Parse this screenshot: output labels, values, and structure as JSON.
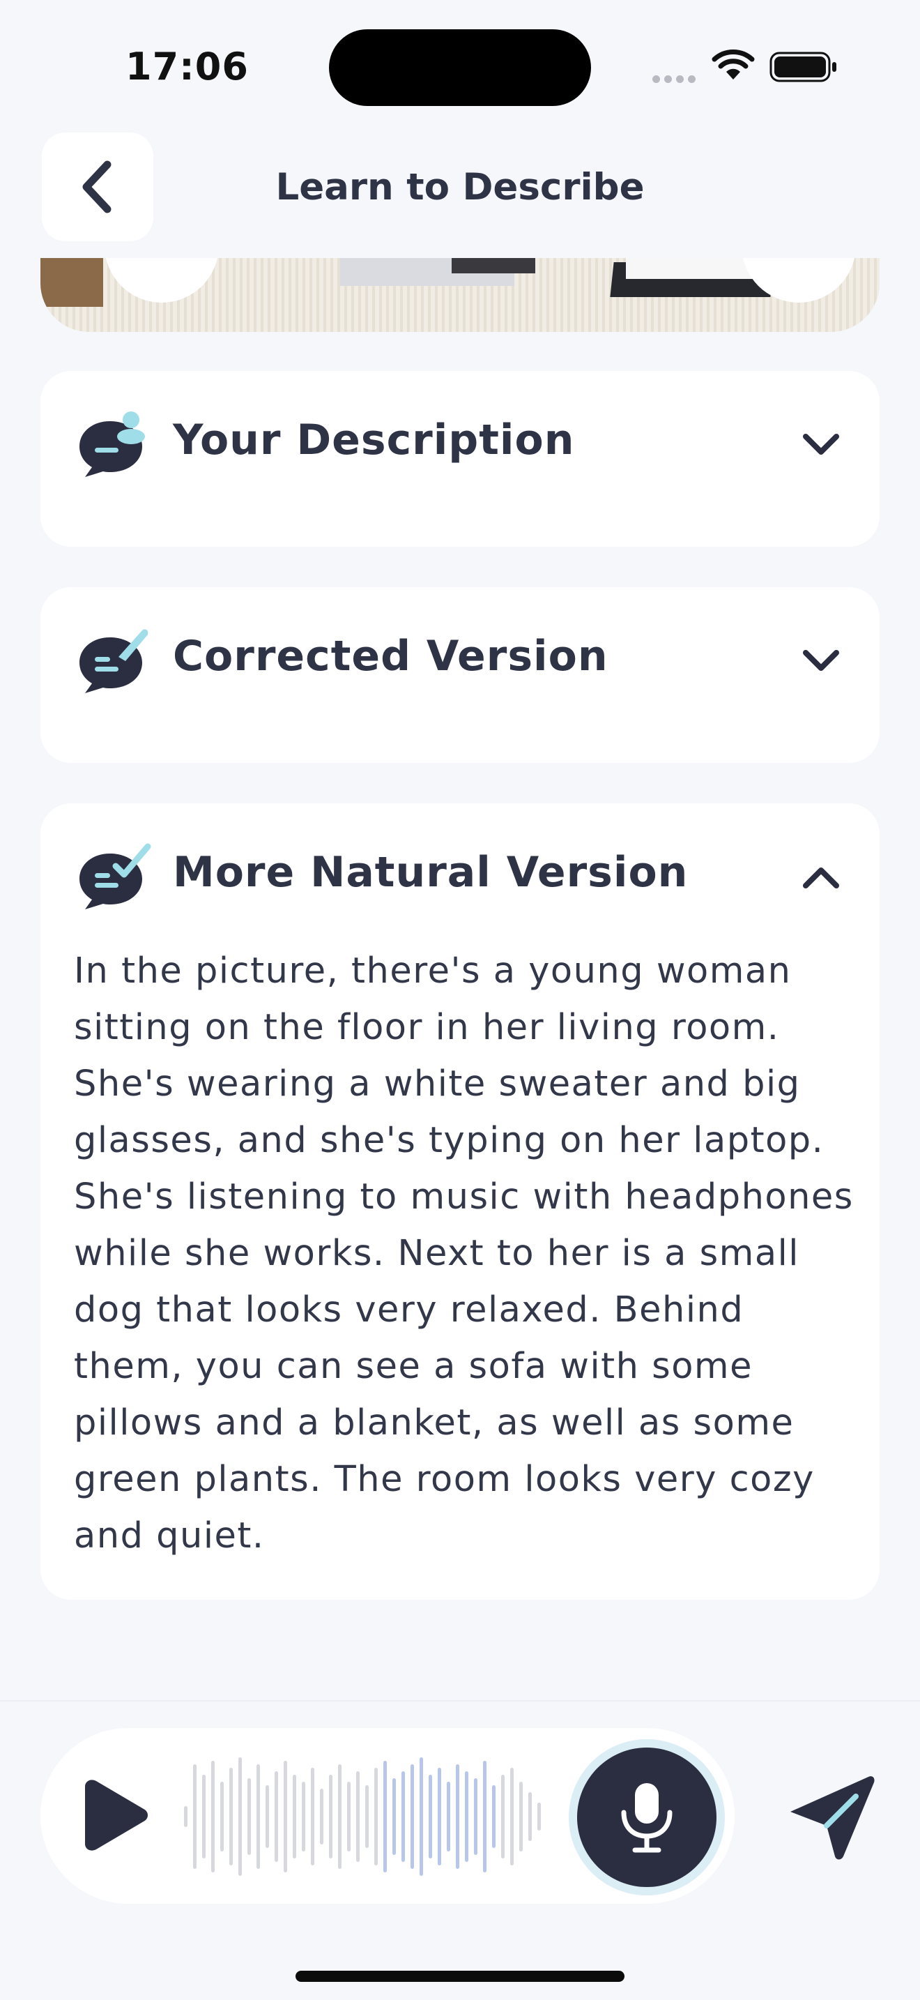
{
  "status_bar": {
    "time": "17:06"
  },
  "header": {
    "title": "Learn to Describe"
  },
  "cards": [
    {
      "title": "Your Description",
      "expanded": false,
      "icon": "chat-person-icon"
    },
    {
      "title": "Corrected Version",
      "expanded": false,
      "icon": "chat-pen-icon"
    },
    {
      "title": "More Natural Version",
      "expanded": true,
      "icon": "chat-check-icon",
      "body": "In the picture, there's a young woman sitting on the floor in her living room. She's wearing a white sweater and big glasses, and she's typing on her laptop. She's listening to music with headphones while she works. Next to her is a small dog that looks very relaxed. Behind them, you can see a sofa with some pillows and a blanket, as well as some green plants. The room looks very cozy and quiet."
    }
  ],
  "recorder": {
    "play_icon": "play-icon",
    "mic_icon": "microphone-icon",
    "send_icon": "send-icon"
  },
  "colors": {
    "accent": "#2a2e40",
    "highlight": "#9fdde8",
    "background": "#f5f7fb",
    "wave_active": "#b9c6ec",
    "wave_idle": "#d6d8de"
  }
}
